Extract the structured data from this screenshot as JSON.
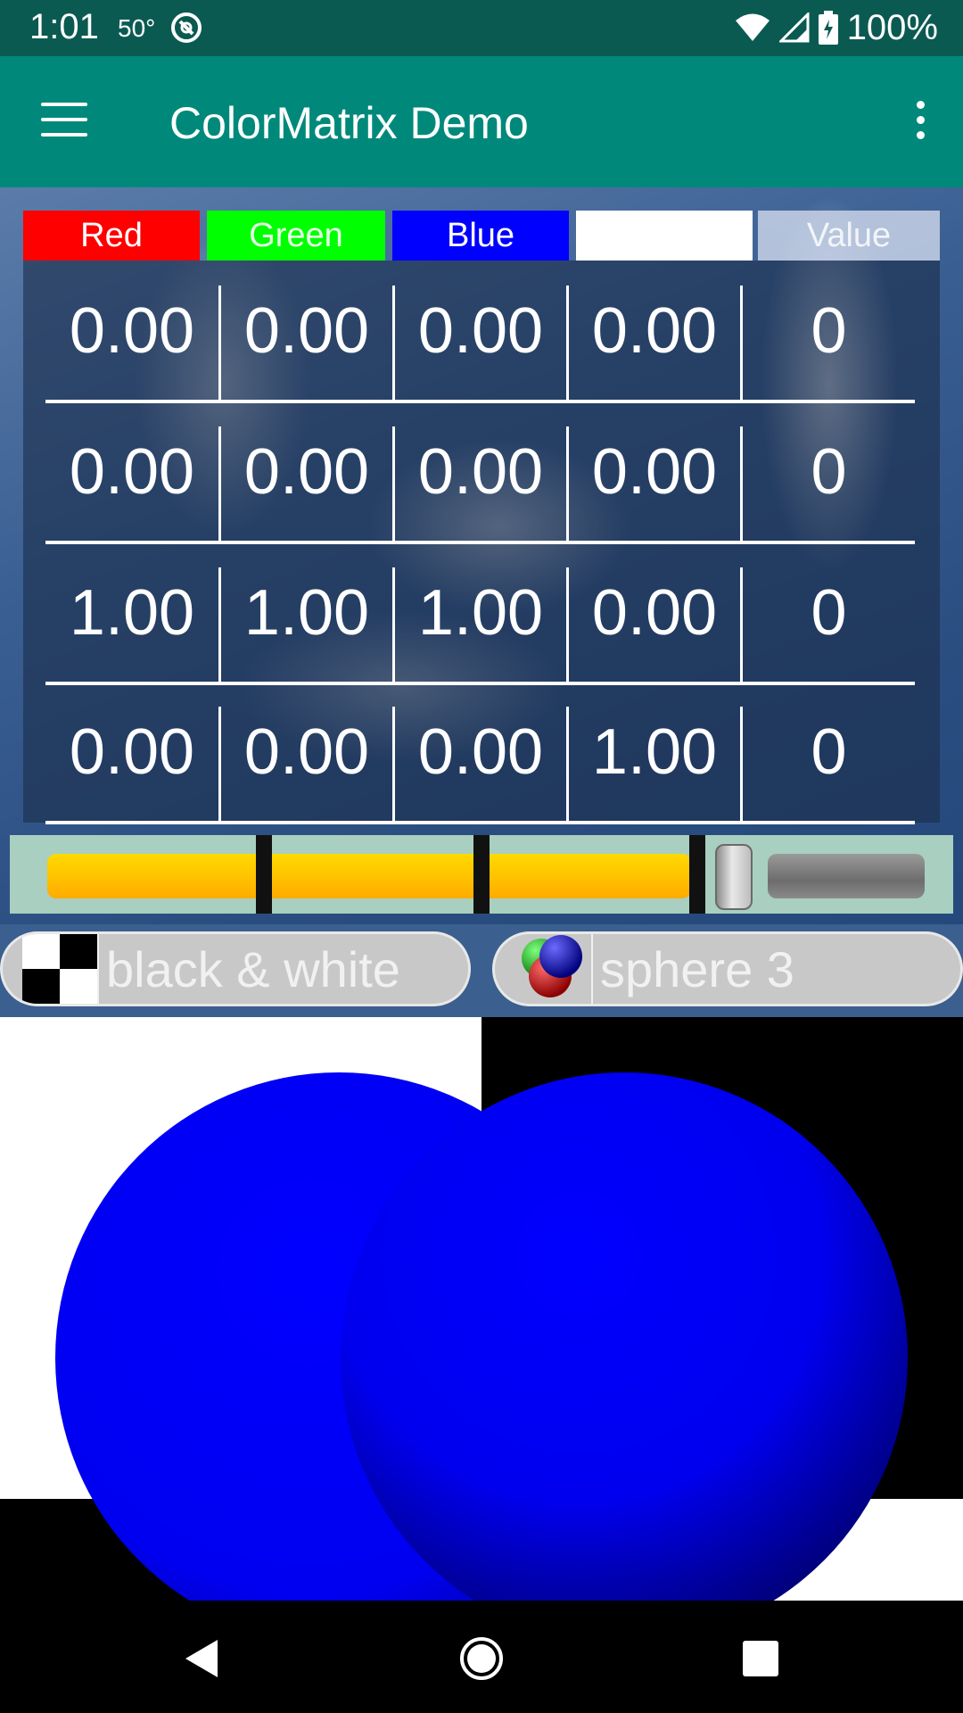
{
  "status_bar": {
    "time": "1:01",
    "temperature": "50°",
    "battery": "100%",
    "icons": [
      "assistant-icon",
      "wifi-icon",
      "cell-signal-icon",
      "battery-charging-icon"
    ]
  },
  "app_bar": {
    "title": "ColorMatrix Demo",
    "icons": [
      "hamburger-menu-icon",
      "more-vert-icon"
    ]
  },
  "matrix": {
    "headers": [
      "Red",
      "Green",
      "Blue",
      "",
      "Value"
    ],
    "header_colors": [
      "#ff0000",
      "#00ff00",
      "#0000ff",
      "#ffffff",
      "#c8d2e6"
    ],
    "rows": [
      [
        "0.00",
        "0.00",
        "0.00",
        "0.00",
        "0"
      ],
      [
        "0.00",
        "0.00",
        "0.00",
        "0.00",
        "0"
      ],
      [
        "1.00",
        "1.00",
        "1.00",
        "0.00",
        "0"
      ],
      [
        "0.00",
        "0.00",
        "0.00",
        "1.00",
        "0"
      ]
    ]
  },
  "slider": {
    "fill_fraction": 0.75,
    "fill_color": "#ffc400"
  },
  "buttons": {
    "filter_label": "black & white",
    "image_label": "sphere 3"
  },
  "nav_bar": {
    "icons": [
      "back-icon",
      "home-icon",
      "recents-icon"
    ]
  }
}
